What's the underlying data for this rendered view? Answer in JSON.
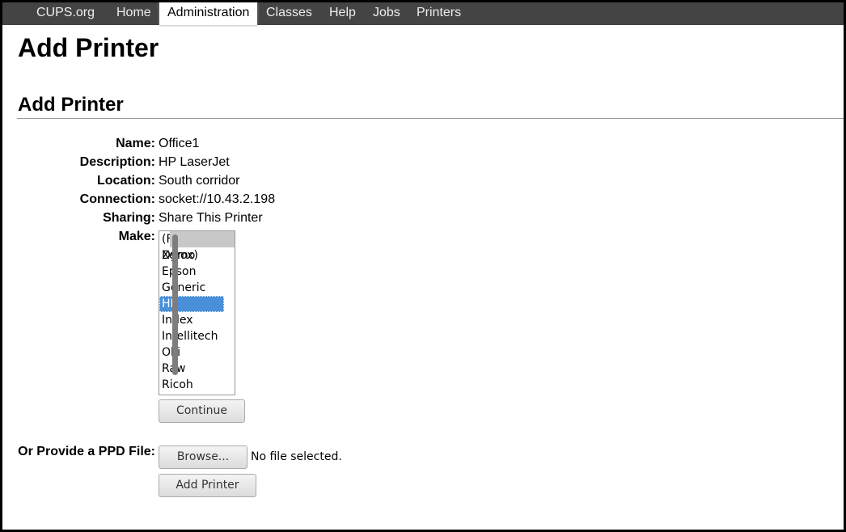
{
  "nav": {
    "items": [
      "CUPS.org",
      "Home",
      "Administration",
      "Classes",
      "Help",
      "Jobs",
      "Printers"
    ],
    "active": "Administration"
  },
  "page_title": "Add Printer",
  "section_title": "Add Printer",
  "fields": [
    {
      "label": "Name:",
      "value": "Office1"
    },
    {
      "label": "Description:",
      "value": "HP LaserJet"
    },
    {
      "label": "Location:",
      "value": "South corridor"
    },
    {
      "label": "Connection:",
      "value": "socket://10.43.2.198"
    },
    {
      "label": "Sharing:",
      "value": "Share This Printer"
    }
  ],
  "make": {
    "label": "Make:",
    "options": [
      "(Fuji Xerox)",
      "Dymo",
      "Epson",
      "Generic",
      "HP",
      "Index",
      "Intellitech",
      "Oki",
      "Raw",
      "Ricoh"
    ],
    "selected": "HP",
    "selection_color": "#4a90d9"
  },
  "continue_label": "Continue",
  "ppd": {
    "label": "Or Provide a PPD File:",
    "browse_label": "Browse...",
    "file_status": "No file selected."
  },
  "add_printer_label": "Add Printer"
}
